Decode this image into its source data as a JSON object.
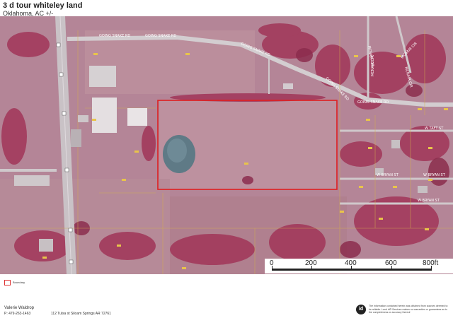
{
  "header": {
    "title": "3 d tour whiteley land",
    "subtitle": "Oklahoma,  AC +/-"
  },
  "map": {
    "roads": {
      "going_snake_rd_1": "GOING SNAKE RD",
      "going_snake_rd_2": "GOING SNAKE RD",
      "going_snake_rd_3": "GOING SNAKE RD",
      "going_snake_rd_4": "GOING SNAKE RD",
      "going_snake_rd_5": "GOING SNAKE RD",
      "mcnair_cir_1": "MCNAIR CIR",
      "mcnair_cir_2": "MCNAIR CIR",
      "mcnair_cir_3": "MCNAIR CIR",
      "mcnair_cir_4": "MCNAIR CIR",
      "w_taft_st": "W TAFT ST",
      "w_bryan_st_1": "W BRYAN ST",
      "w_bryan_st_2": "W BRYAN ST",
      "w_bryan_st_3": "W BRYAN ST"
    },
    "boundary_color": "#e02020",
    "imagery_tint": "#b07f91"
  },
  "scale_bar": {
    "labels": [
      "0",
      "200",
      "400",
      "600",
      "800ft"
    ]
  },
  "legend": {
    "label": "Boundary"
  },
  "footer": {
    "agent_name": "Valerie Waldrop",
    "agent_phone": "P: 479-263-1463",
    "agent_address": "112 Tulsa st  Siloam Springs AR 72761",
    "logo_text": "id",
    "disclaimer": "The information contained herein was obtained from sources deemed to be reliable. Land id® Services makes no warranties or guarantees as to the completeness or accuracy thereof."
  }
}
